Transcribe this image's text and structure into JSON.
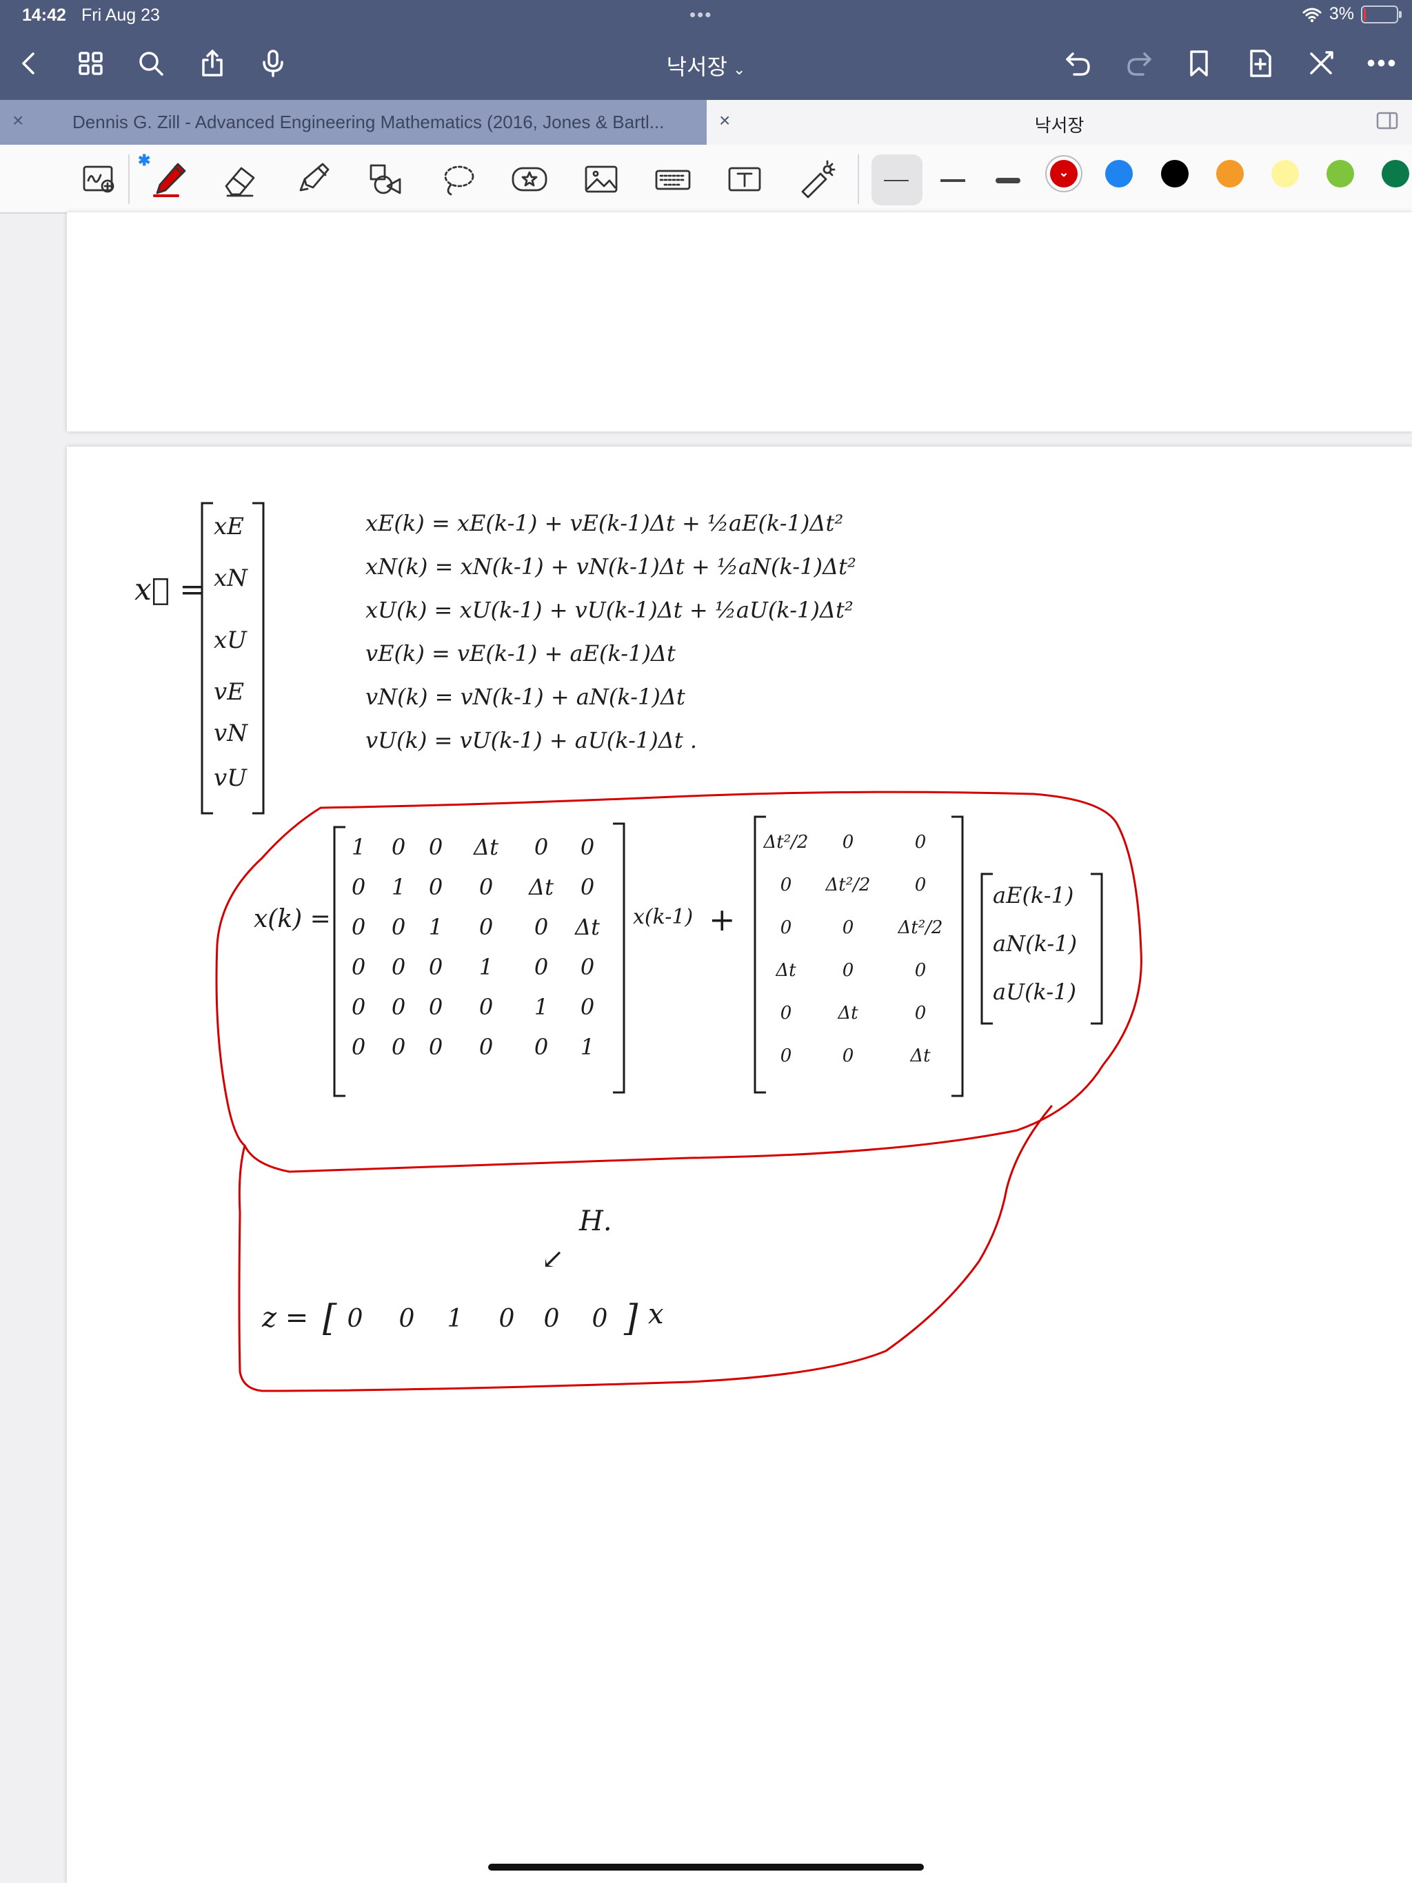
{
  "status_bar": {
    "time": "14:42",
    "date": "Fri Aug 23",
    "dots": "•••",
    "battery": "3%",
    "battery_level": 0.03
  },
  "nav": {
    "title": "낙서장",
    "more": "•••"
  },
  "tabs": [
    {
      "label": "Dennis G. Zill - Advanced Engineering Mathematics (2016, Jones & Bartl...",
      "close": "×",
      "active": false
    },
    {
      "label": "낙서장",
      "close": "×",
      "active": true
    }
  ],
  "toolbar": {
    "bluetooth": "✱",
    "tools": [
      "lasso-zoom",
      "pen",
      "eraser",
      "highlighter",
      "shapes",
      "lasso",
      "sticker",
      "image",
      "keyboard",
      "text",
      "laser-pointer"
    ],
    "selected_tool": "pen",
    "widths": [
      "thin",
      "medium",
      "thick"
    ],
    "selected_width": "thin",
    "colors": [
      "#d40000",
      "#1f84f0",
      "#000000",
      "#f39a28",
      "#fff59c",
      "#7fc43d",
      "#0a7a4a"
    ],
    "selected_color": "#d40000",
    "selected_mark": "⌄"
  },
  "notes": {
    "state_vector": {
      "lhs": "x⃗ =",
      "entries": [
        "xE",
        "xN",
        "xU",
        "vE",
        "vN",
        "vU"
      ]
    },
    "update_equations": [
      "xE(k) = xE(k-1) + vE(k-1)Δt + ½aE(k-1)Δt²",
      "xN(k) = xN(k-1) + vN(k-1)Δt + ½aN(k-1)Δt²",
      "xU(k) = xU(k-1) + vU(k-1)Δt + ½aU(k-1)Δt²",
      "vE(k) = vE(k-1) + aE(k-1)Δt",
      "vN(k) = vN(k-1) + aN(k-1)Δt",
      "vU(k) = vU(k-1) + aU(k-1)Δt ."
    ],
    "transition": {
      "lhs": "x(k) =",
      "F": [
        [
          "1",
          "0",
          "0",
          "Δt",
          "0",
          "0"
        ],
        [
          "0",
          "1",
          "0",
          "0",
          "Δt",
          "0"
        ],
        [
          "0",
          "0",
          "1",
          "0",
          "0",
          "Δt"
        ],
        [
          "0",
          "0",
          "0",
          "1",
          "0",
          "0"
        ],
        [
          "0",
          "0",
          "0",
          "0",
          "1",
          "0"
        ],
        [
          "0",
          "0",
          "0",
          "0",
          "0",
          "1"
        ]
      ],
      "prev_state": "x(k-1)",
      "plus": "+",
      "G": [
        [
          "Δt²/2",
          "0",
          "0"
        ],
        [
          "0",
          "Δt²/2",
          "0"
        ],
        [
          "0",
          "0",
          "Δt²/2"
        ],
        [
          "Δt",
          "0",
          "0"
        ],
        [
          "0",
          "Δt",
          "0"
        ],
        [
          "0",
          "0",
          "Δt"
        ]
      ],
      "accel": [
        "aE(k-1)",
        "aN(k-1)",
        "aU(k-1)"
      ]
    },
    "measurement": {
      "lhs": "z =",
      "H": [
        "0",
        "0",
        "1",
        "0",
        "0",
        "0"
      ],
      "rhs": "x",
      "H_label": "H.",
      "arrow": "↙"
    },
    "ink_color": "#d40000"
  }
}
